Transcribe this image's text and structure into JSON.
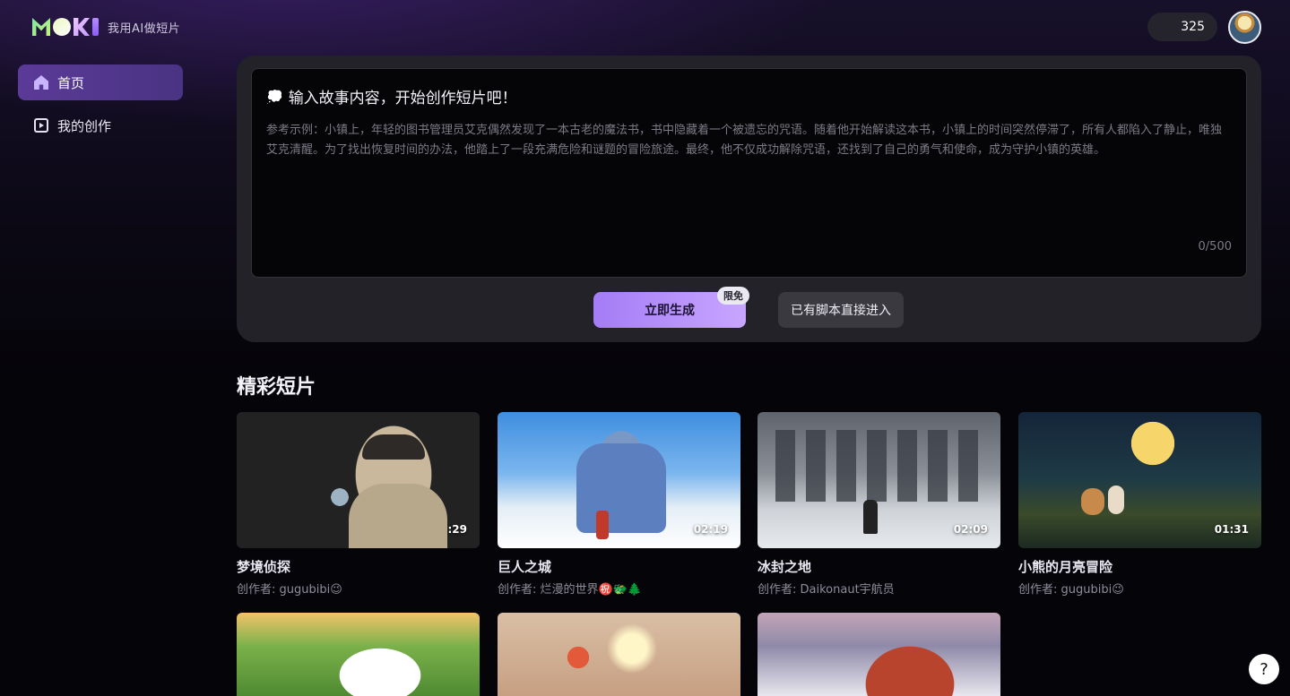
{
  "header": {
    "tagline": "我用AI做短片",
    "points": "325"
  },
  "sidebar": {
    "items": [
      {
        "label": "首页",
        "icon": "home-icon",
        "active": true
      },
      {
        "label": "我的创作",
        "icon": "creation-icon",
        "active": false
      }
    ]
  },
  "compose": {
    "title": "输入故事内容，开始创作短片吧！",
    "placeholder": "参考示例：小镇上，年轻的图书管理员艾克偶然发现了一本古老的魔法书，书中隐藏着一个被遗忘的咒语。随着他开始解读这本书，小镇上的时间突然停滞了，所有人都陷入了静止，唯独艾克清醒。为了找出恢复时间的办法，他踏上了一段充满危险和谜题的冒险旅途。最终，他不仅成功解除咒语，还找到了自己的勇气和使命，成为守护小镇的英雄。",
    "counter": "0/500",
    "generate_label": "立即生成",
    "badge": "限免",
    "script_label": "已有脚本直接进入"
  },
  "gallery": {
    "title": "精彩短片",
    "cards": [
      {
        "title": "梦境侦探",
        "author": "创作者: gugubibi😉",
        "duration": "01:29"
      },
      {
        "title": "巨人之城",
        "author": "创作者: 烂漫的世界㊗️🐲🌲",
        "duration": "02:19"
      },
      {
        "title": "冰封之地",
        "author": "创作者: Daikonaut宇航员",
        "duration": "02:09"
      },
      {
        "title": "小熊的月亮冒险",
        "author": "创作者: gugubibi😉",
        "duration": "01:31"
      },
      {
        "title": "",
        "author": "",
        "duration": ""
      },
      {
        "title": "",
        "author": "",
        "duration": ""
      },
      {
        "title": "",
        "author": "",
        "duration": ""
      }
    ]
  },
  "help": {
    "label": "?"
  },
  "colors": {
    "accent": "#a47cf6",
    "panel": "#232228",
    "active_nav": "#5b3a98"
  }
}
